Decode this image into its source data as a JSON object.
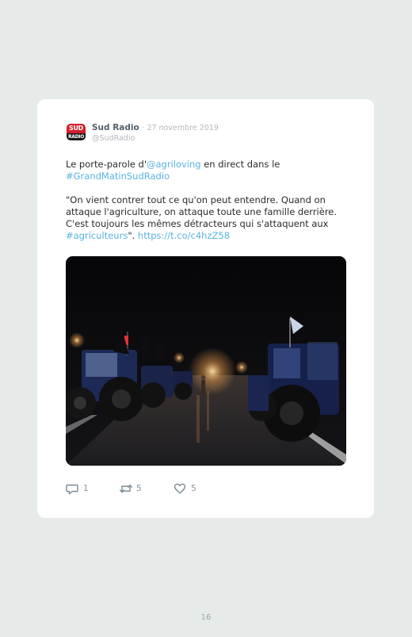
{
  "tweet": {
    "avatar": {
      "top_text": "SUD",
      "bottom_text": "RADIO"
    },
    "author_name": "Sud Radio",
    "separator": "·",
    "date": "27 novembre 2019",
    "handle": "@SudRadio",
    "paragraph1": {
      "prefix": "Le porte-parole d'",
      "mention": "@agriloving",
      "middle": " en direct dans le",
      "hashtag": "#GrandMatinSudRadio"
    },
    "paragraph2": {
      "quote": "\"On vient contrer tout ce qu'on peut entendre. Quand on attaque l'agriculture, on attaque toute une famille derrière. C'est toujours les mêmes détracteurs qui s'attaquent aux ",
      "hashtag": "#agriculteurs",
      "suffix": "\". ",
      "url": "https://t.co/c4hzZ58"
    },
    "media": {
      "description_icon": "photo-tractors-night"
    },
    "actions": {
      "reply_count": "1",
      "retweet_count": "5",
      "like_count": "5"
    },
    "colors": {
      "link": "#5ab4e0",
      "brand_red": "#d4202a"
    }
  },
  "page": {
    "number": "16"
  }
}
